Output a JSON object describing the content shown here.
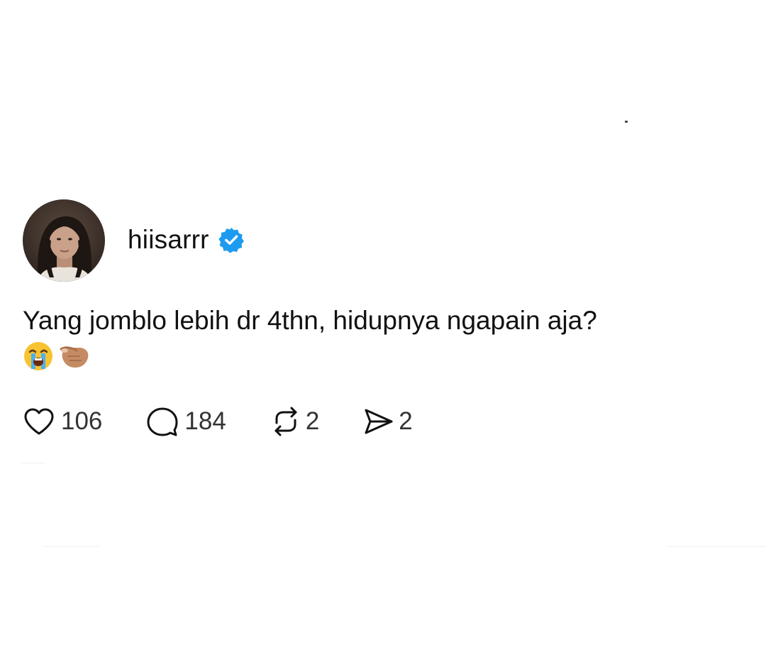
{
  "post": {
    "username": "hiisarrr",
    "verified_icon": "verified-badge-icon",
    "text": "Yang jomblo lebih dr 4thn, hidupnya ngapain aja?",
    "emojis": [
      "crying-face-emoji",
      "pinching-hand-emoji"
    ],
    "actions": {
      "like": {
        "icon": "heart-icon",
        "count": "106"
      },
      "comment": {
        "icon": "comment-bubble-icon",
        "count": "184"
      },
      "repost": {
        "icon": "repost-icon",
        "count": "2"
      },
      "share": {
        "icon": "send-icon",
        "count": "2"
      }
    }
  },
  "colors": {
    "verified": "#1d9bf0",
    "text": "#111111",
    "count": "#333333",
    "background": "#ffffff"
  }
}
